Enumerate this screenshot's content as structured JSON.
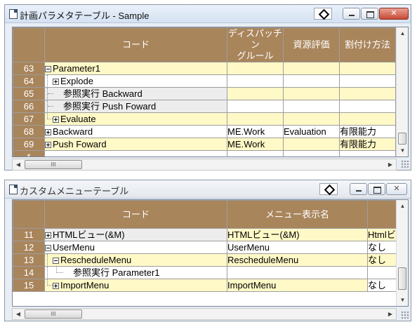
{
  "window1": {
    "title": "計画パラメタテーブル - Sample",
    "columns": [
      "コード",
      "ディスパッチン\nグルール",
      "資源評価",
      "割付け方法"
    ],
    "rows": [
      {
        "num": "63",
        "code": "Parameter1",
        "dispatch": "",
        "eval": "",
        "assign": ""
      },
      {
        "num": "64",
        "code": "Explode",
        "dispatch": "",
        "eval": "",
        "assign": ""
      },
      {
        "num": "65",
        "code": "参照実行 Backward",
        "dispatch": "",
        "eval": "",
        "assign": ""
      },
      {
        "num": "66",
        "code": "参照実行 Push Foward",
        "dispatch": "",
        "eval": "",
        "assign": ""
      },
      {
        "num": "67",
        "code": "Evaluate",
        "dispatch": "",
        "eval": "",
        "assign": ""
      },
      {
        "num": "68",
        "code": "Backward",
        "dispatch": "ME.Work",
        "eval": "Evaluation",
        "assign": "有限能力"
      },
      {
        "num": "69",
        "code": "Push Foward",
        "dispatch": "ME.Work",
        "eval": "",
        "assign": "有限能力"
      },
      {
        "num": "*",
        "code": "",
        "dispatch": "",
        "eval": "",
        "assign": ""
      }
    ],
    "hscroll_thumb": "III"
  },
  "window2": {
    "title": "カスタムメニューテーブル",
    "columns": [
      "コード",
      "メニュー表示名",
      ""
    ],
    "rows": [
      {
        "num": "11",
        "code": "HTMLビュー(&M)",
        "name": "HTMLビュー(&M)",
        "extra": "Htmlビ"
      },
      {
        "num": "12",
        "code": "UserMenu",
        "name": "UserMenu",
        "extra": "なし"
      },
      {
        "num": "13",
        "code": "RescheduleMenu",
        "name": "RescheduleMenu",
        "extra": "なし"
      },
      {
        "num": "14",
        "code": "参照実行 Parameter1",
        "name": "",
        "extra": ""
      },
      {
        "num": "15",
        "code": "ImportMenu",
        "name": "ImportMenu",
        "extra": "なし"
      }
    ],
    "hscroll_thumb": "III"
  }
}
